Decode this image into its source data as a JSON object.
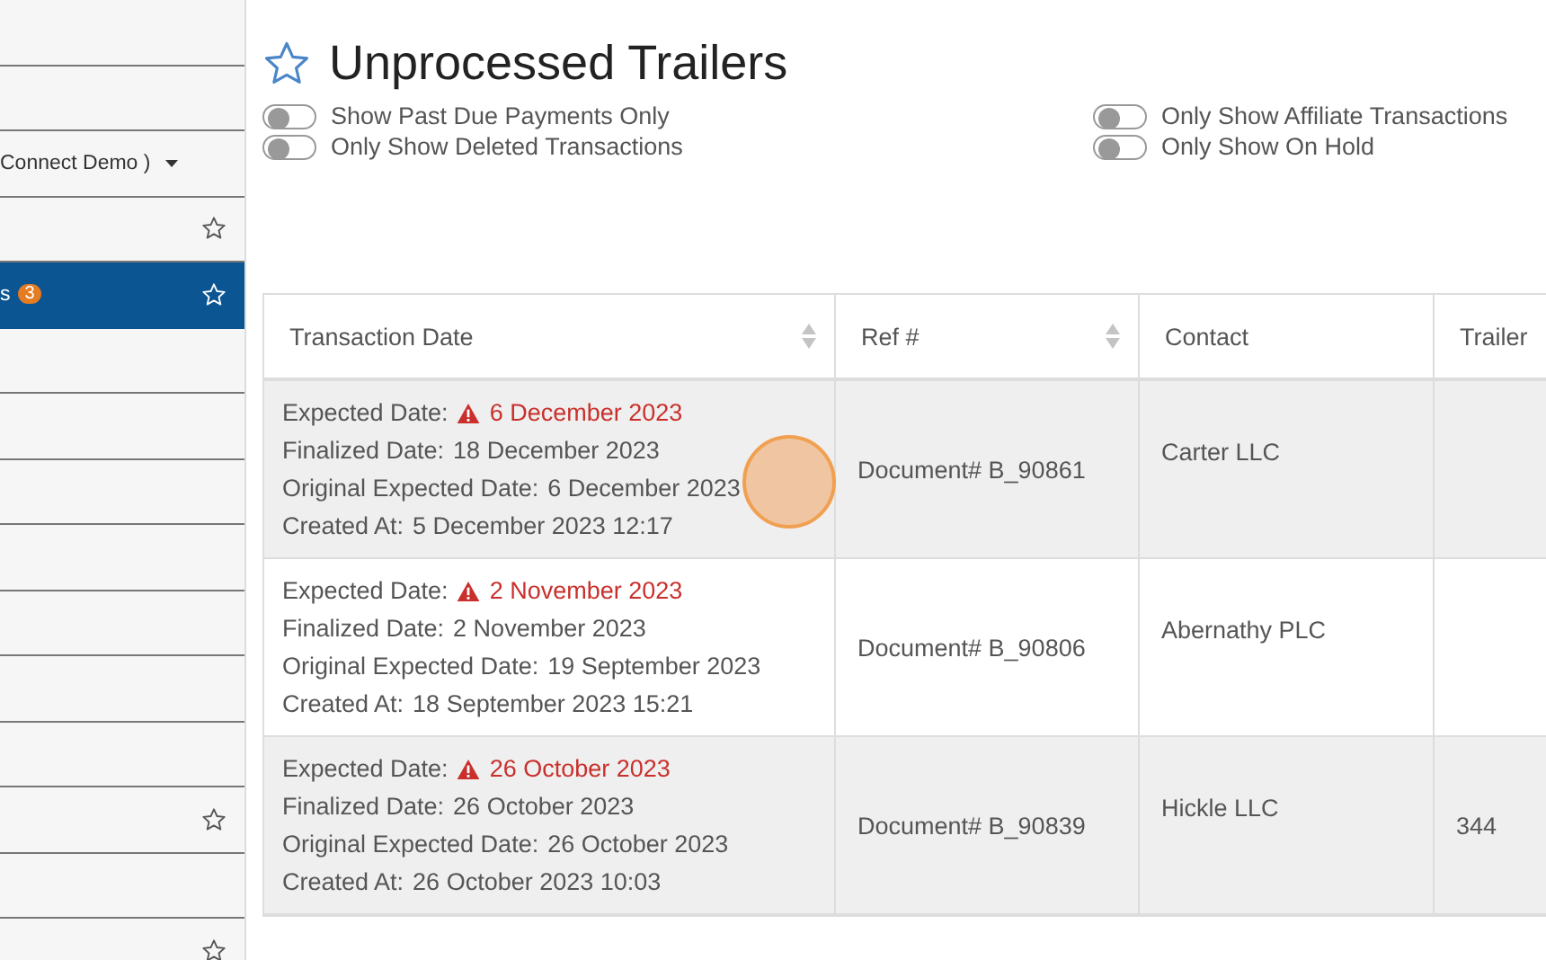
{
  "sidebar": {
    "items": [
      {
        "selected": false,
        "starred": false
      },
      {
        "selected": false,
        "starred": false
      },
      {
        "label": "Connect Demo )",
        "dropdown": true,
        "selected": false,
        "starred": false
      },
      {
        "selected": false,
        "starred": true
      },
      {
        "label": "s",
        "badge": "3",
        "selected": true,
        "starred": true
      },
      {
        "selected": false,
        "starred": false
      },
      {
        "selected": false,
        "starred": false
      },
      {
        "selected": false,
        "starred": false
      },
      {
        "selected": false,
        "starred": false
      },
      {
        "selected": false,
        "starred": false
      },
      {
        "selected": false,
        "starred": false
      },
      {
        "selected": false,
        "starred": false
      },
      {
        "selected": false,
        "starred": true
      },
      {
        "selected": false,
        "starred": false
      },
      {
        "selected": false,
        "starred": true
      }
    ]
  },
  "page": {
    "title": "Unprocessed Trailers"
  },
  "filters": [
    {
      "label": "Show Past Due Payments Only",
      "on": false
    },
    {
      "label": "Only Show Affiliate Transactions",
      "on": false
    },
    {
      "label": "Only Show Deleted Transactions",
      "on": false
    },
    {
      "label": "Only Show On Hold",
      "on": false
    }
  ],
  "table": {
    "columns": [
      {
        "label": "Transaction Date",
        "sortable": true
      },
      {
        "label": "Ref #",
        "sortable": true
      },
      {
        "label": "Contact",
        "sortable": false
      },
      {
        "label": "Trailer",
        "sortable": false
      }
    ],
    "rows": [
      {
        "dates": [
          {
            "label": "Expected Date:",
            "value": "6 December 2023",
            "alert": true
          },
          {
            "label": "Finalized Date:",
            "value": "18 December 2023",
            "alert": false
          },
          {
            "label": "Original Expected Date:",
            "value": "6 December 2023",
            "alert": false
          },
          {
            "label": "Created At:",
            "value": "5 December 2023 12:17",
            "alert": false
          }
        ],
        "ref": "Document# B_90861",
        "contact": "Carter LLC"
      },
      {
        "dates": [
          {
            "label": "Expected Date:",
            "value": "2 November 2023",
            "alert": true
          },
          {
            "label": "Finalized Date:",
            "value": "2 November 2023",
            "alert": false
          },
          {
            "label": "Original Expected Date:",
            "value": "19 September 2023",
            "alert": false
          },
          {
            "label": "Created At:",
            "value": "18 September 2023 15:21",
            "alert": false
          }
        ],
        "ref": "Document# B_90806",
        "contact": "Abernathy PLC"
      },
      {
        "dates": [
          {
            "label": "Expected Date:",
            "value": "26 October 2023",
            "alert": true
          },
          {
            "label": "Finalized Date:",
            "value": "26 October 2023",
            "alert": false
          },
          {
            "label": "Original Expected Date:",
            "value": "26 October 2023",
            "alert": false
          },
          {
            "label": "Created At:",
            "value": "26 October 2023 10:03",
            "alert": false
          }
        ],
        "ref": "Document# B_90839",
        "contact": "Hickle LLC",
        "trailer": "344"
      }
    ]
  }
}
